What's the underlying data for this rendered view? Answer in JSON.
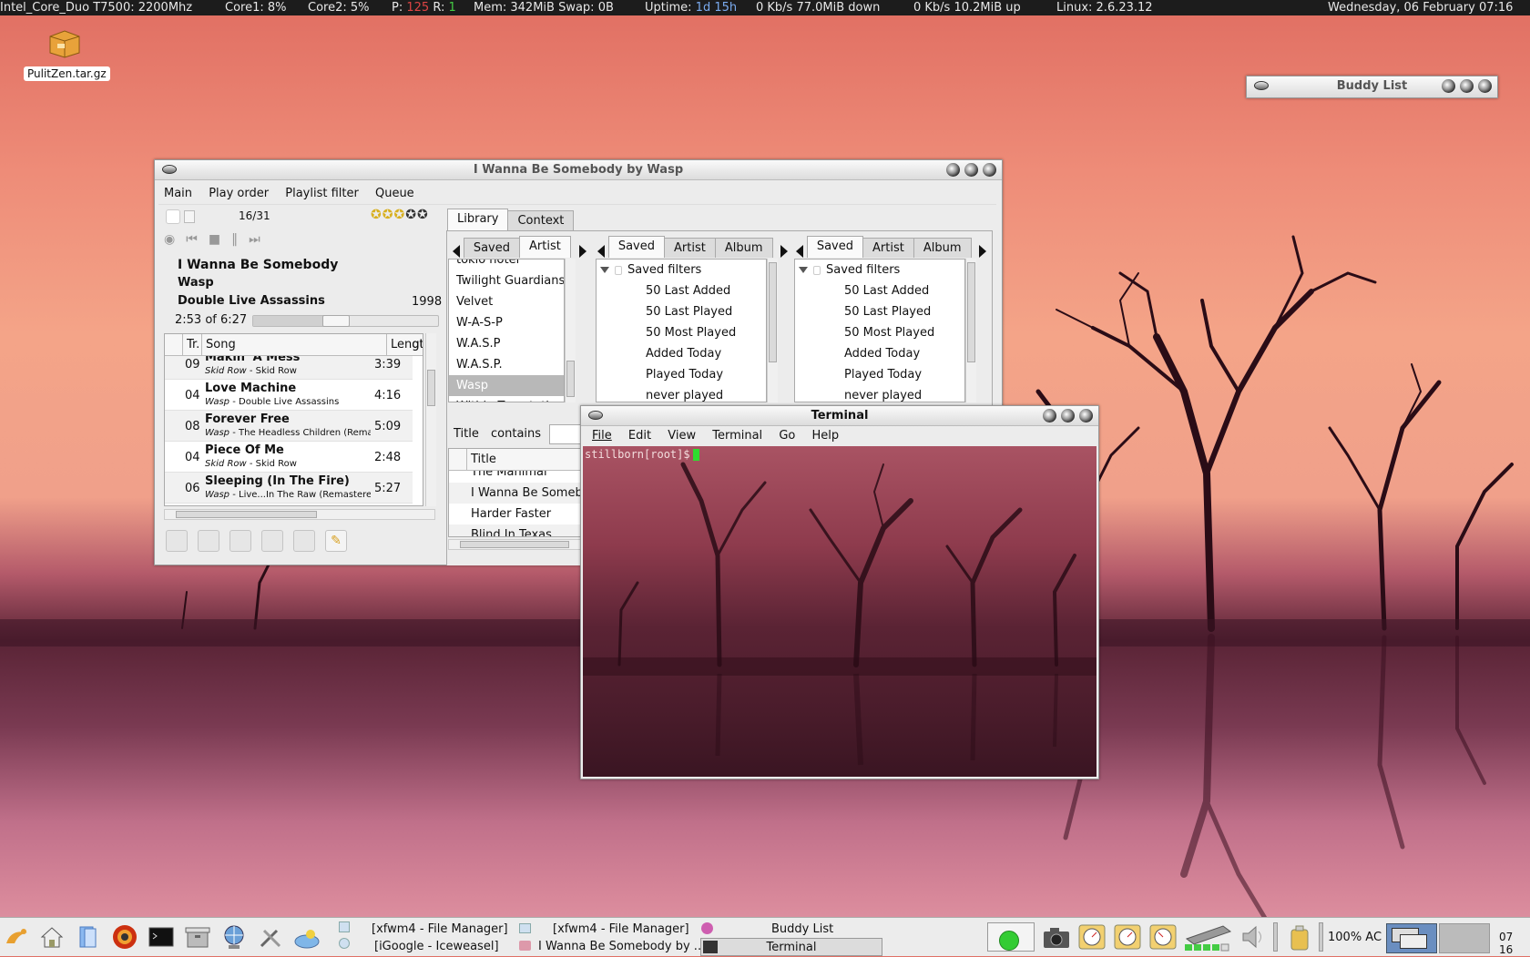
{
  "topbar": {
    "cpu": "Intel_Core_Duo T7500: 2200Mhz",
    "core1": "Core1: 8%",
    "core2": "Core2: 5%",
    "procs_p_label": "P:",
    "procs_p": "125",
    "procs_r_label": "R:",
    "procs_r": "1",
    "mem": "Mem: 342MiB Swap: 0B",
    "uptime_label": "Uptime:",
    "uptime": "1d 15h",
    "down": "0 Kb/s  77.0MiB down",
    "up": "0 Kb/s  10.2MiB up",
    "kernel": "Linux: 2.6.23.12",
    "datetime": "Wednesday, 06 February 07:16"
  },
  "desktop_icon": {
    "label": "PulitZen.tar.gz"
  },
  "buddy": {
    "title": "Buddy List"
  },
  "player": {
    "title": "I Wanna Be Somebody by Wasp",
    "menu": [
      "Main",
      "Play order",
      "Playlist filter",
      "Queue"
    ],
    "position": "16/31",
    "song": "I Wanna Be Somebody",
    "artist": "Wasp",
    "album": "Double Live Assassins",
    "year": "1998",
    "time": "2:53 of 6:27",
    "progress": 0.45,
    "rating": 3,
    "columns": {
      "track": "Tr.",
      "song": "Song",
      "length": "Length"
    },
    "tracks": [
      {
        "tr": "09",
        "title": "Makin' A Mess",
        "artist": "Skid Row",
        "album": " - Skid Row",
        "length": "3:39"
      },
      {
        "tr": "04",
        "title": "Love Machine",
        "artist": "Wasp",
        "album": " - Double Live Assassins",
        "length": "4:16"
      },
      {
        "tr": "08",
        "title": "Forever Free",
        "artist": "Wasp",
        "album": " - The Headless Children (Rema",
        "length": "5:09"
      },
      {
        "tr": "04",
        "title": "Piece Of Me",
        "artist": "Skid Row",
        "album": " - Skid Row",
        "length": "2:48"
      },
      {
        "tr": "06",
        "title": "Sleeping (In The Fire)",
        "artist": "Wasp",
        "album": " - Live...In The Raw (Remasterec",
        "length": "5:27"
      }
    ],
    "main_tabs": [
      "Library",
      "Context"
    ],
    "pane1": {
      "tabs": [
        "Saved",
        "Artist"
      ],
      "items": [
        "tokio hotel",
        "Twilight Guardians",
        "Velvet",
        "W-A-S-P",
        "W.A.S.P",
        "W.A.S.P.",
        "Wasp",
        "Within Temptation"
      ],
      "selected": "Wasp"
    },
    "pane2": {
      "tabs": [
        "Saved",
        "Artist",
        "Album"
      ],
      "root": "Saved filters",
      "items": [
        "50 Last Added",
        "50 Last Played",
        "50 Most Played",
        "Added Today",
        "Played Today",
        "never played"
      ]
    },
    "pane3": {
      "tabs": [
        "Saved",
        "Artist",
        "Album"
      ],
      "root": "Saved filters",
      "items": [
        "50 Last Added",
        "50 Last Played",
        "50 Most Played",
        "Added Today",
        "Played Today",
        "never played"
      ]
    },
    "filter": {
      "field": "Title",
      "op": "contains"
    },
    "results": {
      "column": "Title",
      "items": [
        "The Manimal",
        "I Wanna Be Somebo",
        "Harder Faster",
        "Blind In Texas"
      ]
    }
  },
  "terminal": {
    "title": "Terminal",
    "menu": [
      "File",
      "Edit",
      "View",
      "Terminal",
      "Go",
      "Help"
    ],
    "prompt": "stillborn[root]$"
  },
  "taskbar": {
    "tasks": [
      "[xfwm4 - File Manager]",
      "[iGoogle - Iceweasel]",
      "[xfwm4 - File Manager]",
      "I Wanna Be Somebody by ...",
      "Buddy List",
      "Terminal"
    ],
    "battery": "100% AC",
    "clock": "07 16"
  }
}
